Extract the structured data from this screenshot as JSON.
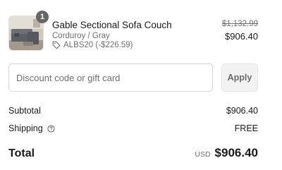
{
  "line_item": {
    "quantity": "1",
    "title": "Gable Sectional Sofa Couch",
    "variant": "Corduroy / Gray",
    "discount": "ALBS20 (-$226.59)",
    "compare_at_price": "$1,132.99",
    "price": "$906.40",
    "icons": {
      "thumbnail": "sofa-thumbnail",
      "discount": "tag-icon"
    }
  },
  "discount_field": {
    "placeholder": "Discount code or gift card",
    "value": "",
    "apply_label": "Apply"
  },
  "summary": {
    "subtotal_label": "Subtotal",
    "subtotal_value": "$906.40",
    "shipping_label": "Shipping",
    "shipping_value": "FREE",
    "shipping_help_icon": "help-circle-icon",
    "total_label": "Total",
    "currency": "USD",
    "total_value": "$906.40"
  },
  "colors": {
    "text": "#1a1a1a",
    "muted": "#707070",
    "badge": "#666666",
    "button_bg": "#f2f2f2",
    "border": "#d6d6d6"
  }
}
